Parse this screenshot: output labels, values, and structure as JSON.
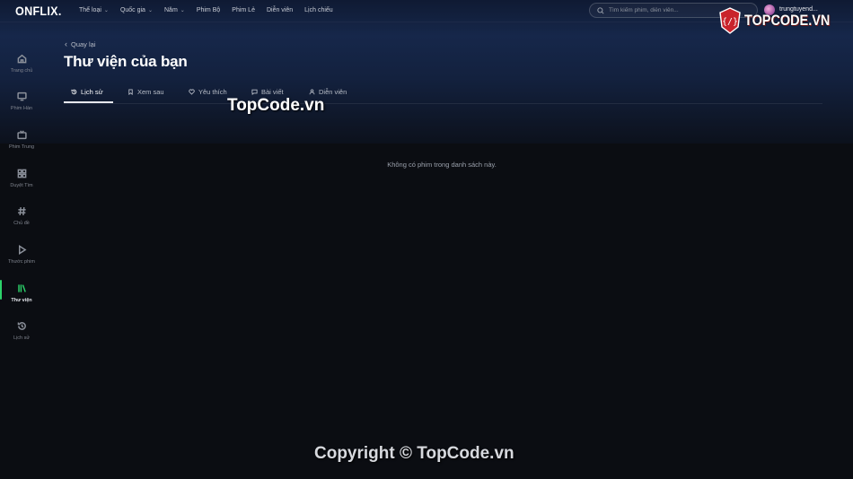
{
  "brand": {
    "logo": "ONFLIX."
  },
  "nav": {
    "items": [
      {
        "label": "Thể loại",
        "dropdown": true
      },
      {
        "label": "Quốc gia",
        "dropdown": true
      },
      {
        "label": "Năm",
        "dropdown": true
      },
      {
        "label": "Phim Bộ",
        "dropdown": false
      },
      {
        "label": "Phim Lẻ",
        "dropdown": false
      },
      {
        "label": "Diễn viên",
        "dropdown": false
      },
      {
        "label": "Lịch chiếu",
        "dropdown": false
      }
    ],
    "chevron": "⌄"
  },
  "search": {
    "placeholder": "Tìm kiếm phim, diễn viên...",
    "icon": "search-icon"
  },
  "user": {
    "name": "trungtuyend..."
  },
  "watermark": {
    "logo_text": "TOPCODE.VN",
    "mid_text": "TopCode.vn",
    "copyright": "Copyright © TopCode.vn"
  },
  "sidebar": {
    "items": [
      {
        "label": "Trang chủ",
        "icon": "home-icon",
        "active": false
      },
      {
        "label": "Phim Hàn",
        "icon": "monitor-icon",
        "active": false
      },
      {
        "label": "Phim Trung",
        "icon": "tv-icon",
        "active": false
      },
      {
        "label": "Duyệt Tìm",
        "icon": "grid-icon",
        "active": false
      },
      {
        "label": "Chủ đề",
        "icon": "hash-icon",
        "active": false
      },
      {
        "label": "Thước phim",
        "icon": "play-icon",
        "active": false
      },
      {
        "label": "Thư viện",
        "icon": "library-icon",
        "active": true
      },
      {
        "label": "Lịch sử",
        "icon": "history-icon",
        "active": false
      }
    ]
  },
  "main": {
    "back_label": "Quay lại",
    "title": "Thư viện của bạn",
    "tabs": [
      {
        "label": "Lịch sử",
        "icon": "history-icon",
        "active": true
      },
      {
        "label": "Xem sau",
        "icon": "bookmark-icon",
        "active": false
      },
      {
        "label": "Yêu thích",
        "icon": "heart-icon",
        "active": false
      },
      {
        "label": "Bài viết",
        "icon": "message-icon",
        "active": false
      },
      {
        "label": "Diễn viên",
        "icon": "user-icon",
        "active": false
      }
    ],
    "empty_message": "Không có phim trong danh sách này."
  },
  "colors": {
    "accent": "#2cd36a",
    "background": "#0b0d12",
    "header": "#16274a"
  }
}
